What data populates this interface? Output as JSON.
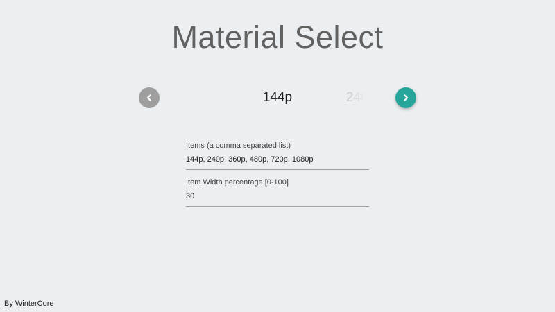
{
  "page": {
    "title": "Material Select",
    "credit": "By WinterCore"
  },
  "selector": {
    "prev_icon": "chevron-left-icon",
    "next_icon": "chevron-right-icon",
    "items": [
      "144p",
      "240p",
      "360p",
      "480p",
      "720p",
      "1080p"
    ],
    "selected": "144p",
    "prev_color": "#9e9e9e",
    "next_color": "#26a69a"
  },
  "form": {
    "items_field": {
      "label": "Items (a comma separated list)",
      "value": "144p, 240p, 360p, 480p, 720p, 1080p"
    },
    "width_field": {
      "label": "Item Width percentage [0-100]",
      "value": "30"
    }
  }
}
